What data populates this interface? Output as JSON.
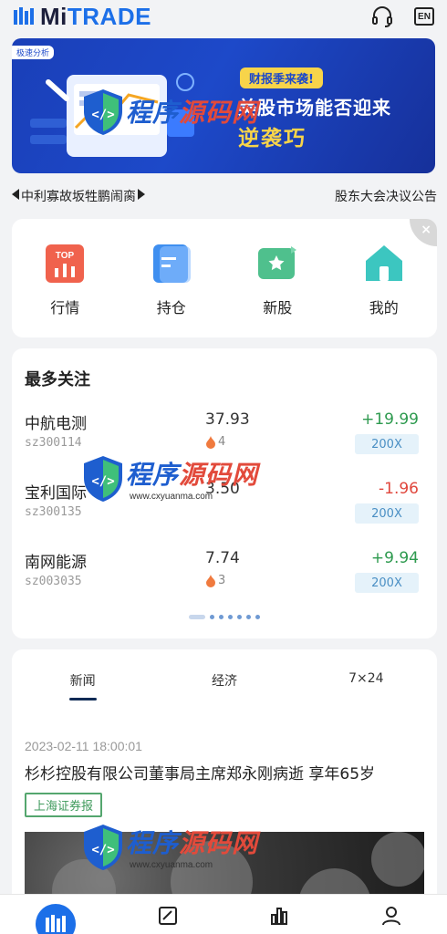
{
  "header": {
    "logo_mi": "Mi",
    "logo_trade": "TRADE",
    "support_icon": "headset-icon",
    "lang_label": "EN"
  },
  "banner": {
    "tag": "极速分析",
    "badge": "财报季来袭!",
    "title": "美股市场能否迎来",
    "subtitle": "逆袭巧"
  },
  "ticker": {
    "left_text": "中利寡故坂牲鹏闹脔",
    "right_text": "股东大会决议公告"
  },
  "quick_menu": {
    "items": [
      {
        "label": "行情",
        "icon": "market-icon",
        "icon_text": "TOP"
      },
      {
        "label": "持仓",
        "icon": "holdings-icon"
      },
      {
        "label": "新股",
        "icon": "ipo-icon"
      },
      {
        "label": "我的",
        "icon": "home-icon"
      }
    ],
    "close_label": "×"
  },
  "watchlist": {
    "title": "最多关注",
    "rows": [
      {
        "name": "中航电测",
        "code": "sz300114",
        "price": "37.93",
        "heat": "4",
        "change": "+19.99",
        "change_dir": "up",
        "leverage": "200X"
      },
      {
        "name": "宝利国际",
        "code": "sz300135",
        "price": "3.50",
        "heat": "",
        "change": "-1.96",
        "change_dir": "down",
        "leverage": "200X"
      },
      {
        "name": "南网能源",
        "code": "sz003035",
        "price": "7.74",
        "heat": "3",
        "change": "+9.94",
        "change_dir": "up",
        "leverage": "200X"
      }
    ]
  },
  "news": {
    "tabs": [
      {
        "label": "新闻",
        "active": true
      },
      {
        "label": "经济",
        "active": false
      },
      {
        "label": "7×24",
        "active": false
      }
    ],
    "date": "2023-02-11 18:00:01",
    "headline": "杉杉控股有限公司董事局主席郑永刚病逝 享年65岁",
    "source": "上海证券报"
  },
  "watermark": {
    "text_a": "程序",
    "text_b": "源码网",
    "url": "www.cxyuanma.com"
  },
  "colors": {
    "brand": "#1c6fe8",
    "up": "#2e9a4f",
    "down": "#e0463c",
    "banner": "#1d49c9",
    "accent_yellow": "#f7d44a"
  },
  "bottom_nav": {
    "items": [
      "home-icon",
      "chart-icon",
      "bar-chart-icon",
      "user-icon"
    ]
  }
}
